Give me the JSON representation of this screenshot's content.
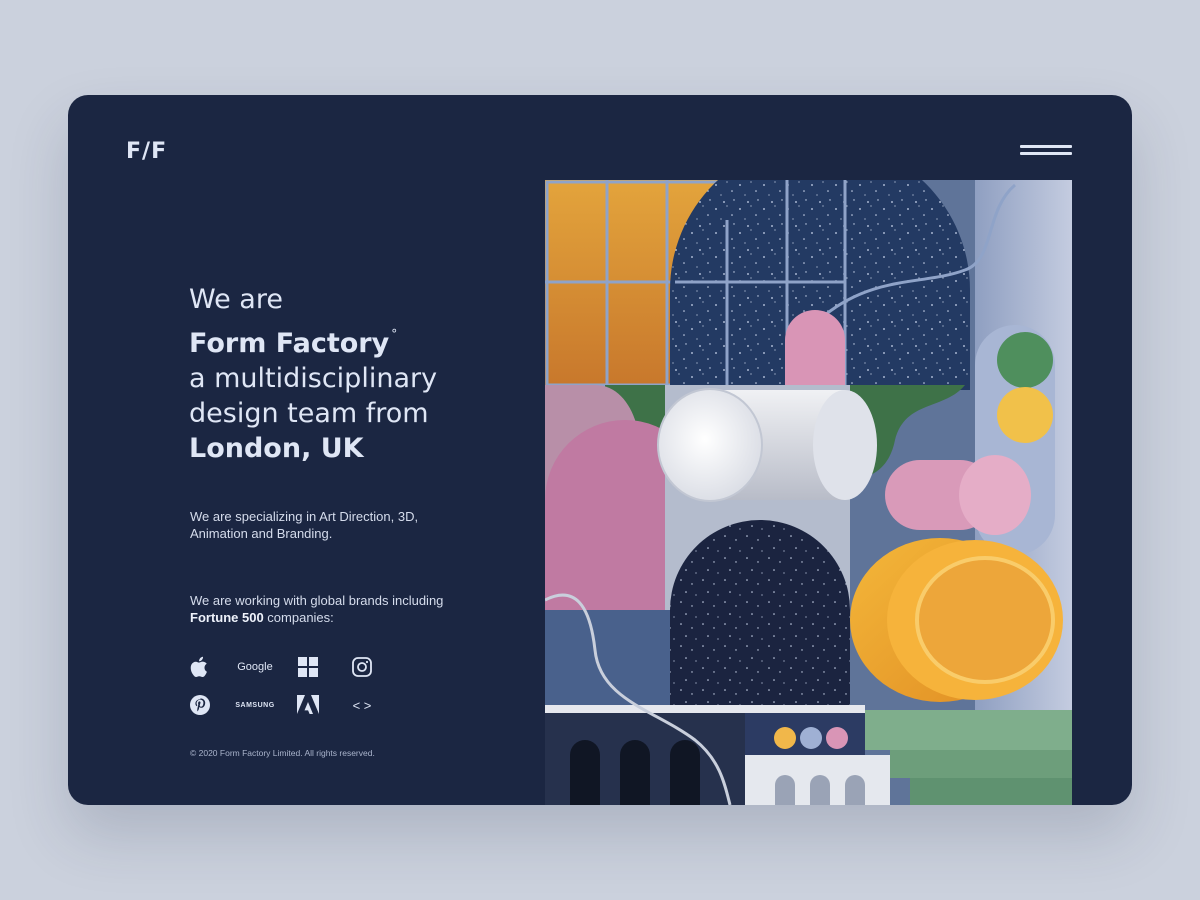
{
  "brand": {
    "logo": "F/F"
  },
  "nav": {
    "menu_icon": "hamburger-icon"
  },
  "hero": {
    "line1": "We are",
    "line2": "Form Factory",
    "line2_mark": "°",
    "line3": "a multidisciplinary",
    "line4": "design team from",
    "line5": "London, UK"
  },
  "about": {
    "specialization": "We are specializing in Art Direction, 3D, Animation and Branding.",
    "clients_prefix": "We are working with global brands including ",
    "clients_bold": "Fortune 500",
    "clients_suffix": " companies:"
  },
  "brands": [
    {
      "name": "apple-logo-icon"
    },
    {
      "name": "google",
      "label": "Google"
    },
    {
      "name": "windows-logo-icon"
    },
    {
      "name": "instagram-icon"
    },
    {
      "name": "pinterest-icon"
    },
    {
      "name": "samsung",
      "label": "SAMSUNG"
    },
    {
      "name": "adobe-logo-icon"
    },
    {
      "name": "code-brackets-icon",
      "label": "< >"
    }
  ],
  "footer": {
    "copyright": "© 2020 Form Factory Limited. All rights reserved."
  },
  "colors": {
    "page_bg": "#cbd1dd",
    "card_bg": "#1b2642",
    "text": "#dfe6f5",
    "accent_orange": "#e8a23a",
    "accent_pink": "#d995b6",
    "accent_green": "#5f9a72"
  }
}
